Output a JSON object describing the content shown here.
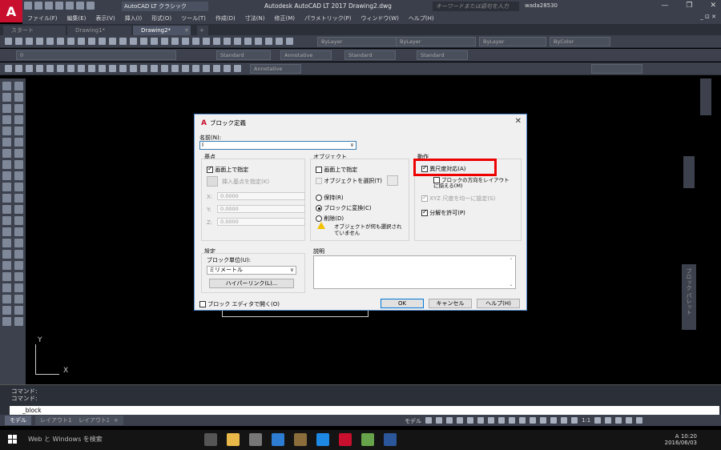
{
  "app": {
    "logo": "A",
    "workspace": "AutoCAD LT クラシック",
    "title": "Autodesk AutoCAD LT 2017   Drawing2.dwg",
    "search_placeholder": "キーワードまたは語句を入力",
    "user": "wada28530",
    "window_controls": [
      "—",
      "❐",
      "✕"
    ]
  },
  "menu": {
    "items": [
      "ファイル(F)",
      "編集(E)",
      "表示(V)",
      "挿入(I)",
      "形式(O)",
      "ツール(T)",
      "作成(D)",
      "寸法(N)",
      "修正(M)",
      "パラメトリック(P)",
      "ウィンドウ(W)",
      "ヘルプ(H)"
    ],
    "right": "_ ⊡ ✕"
  },
  "tabs": {
    "start": "スタート",
    "items": [
      "Drawing1*",
      "Drawing2*"
    ],
    "active": "Drawing2*",
    "close": "✕",
    "add": "+"
  },
  "toolbars": {
    "layer_combo": "ByLayer",
    "linetype_combo": "ByLayer",
    "lineweight_combo": "ByLayer",
    "color_combo": "ByColor",
    "layer_name": "0",
    "text_style": "Standard",
    "dim_style": "Annotative",
    "table_style": "Standard",
    "mleader_style": "Standard",
    "annotative_combo": "Annotative"
  },
  "canvas": {
    "ucs_x": "X",
    "ucs_y": "Y"
  },
  "right_palette": {
    "label": "ブロック パレット"
  },
  "command": {
    "history": [
      "コマンド:",
      "コマンド:"
    ],
    "input": "_block"
  },
  "layout_tabs": [
    "モデル",
    "レイアウト1",
    "レイアウト2"
  ],
  "layout_tab_add": "+",
  "status": {
    "model": "モデル",
    "scale": "1:1"
  },
  "taskbar": {
    "search": "Web と Windows を検索",
    "time": "10:20",
    "date": "2016/06/03",
    "ime": "A"
  },
  "dialog": {
    "title": "ブロック定義",
    "close": "✕",
    "name_label": "名前(N):",
    "name_value": "I",
    "base_point": {
      "header": "基点",
      "specify_on_screen": "画面上で指定",
      "pick_point": "挿入基点を指定(K)",
      "x_label": "X:",
      "y_label": "Y:",
      "z_label": "Z:",
      "x": "0.0000",
      "y": "0.0000",
      "z": "0.0000"
    },
    "objects": {
      "header": "オブジェクト",
      "specify_on_screen": "画面上で指定",
      "select_objects": "オブジェクトを選択(T)",
      "retain": "保持(R)",
      "convert": "ブロックに変換(C)",
      "delete": "削除(D)",
      "warning": "オブジェクトが何も選択されていません"
    },
    "behavior": {
      "header": "動作",
      "annotative": "異尺度対応(A)",
      "match_orientation": "ブロックの方向をレイアウトに揃える(M)",
      "uniform_scale": "XYZ 尺度を均一に設定(S)",
      "allow_explode": "分解を許可(P)"
    },
    "settings": {
      "header": "設定",
      "block_unit_label": "ブロック単位(U):",
      "block_unit_value": "ミリメートル",
      "hyperlink": "ハイパーリンク(L)..."
    },
    "description": {
      "header": "説明"
    },
    "open_in_editor": "ブロック エディタで開く(O)",
    "ok": "OK",
    "cancel": "キャンセル",
    "help": "ヘルプ(H)"
  }
}
